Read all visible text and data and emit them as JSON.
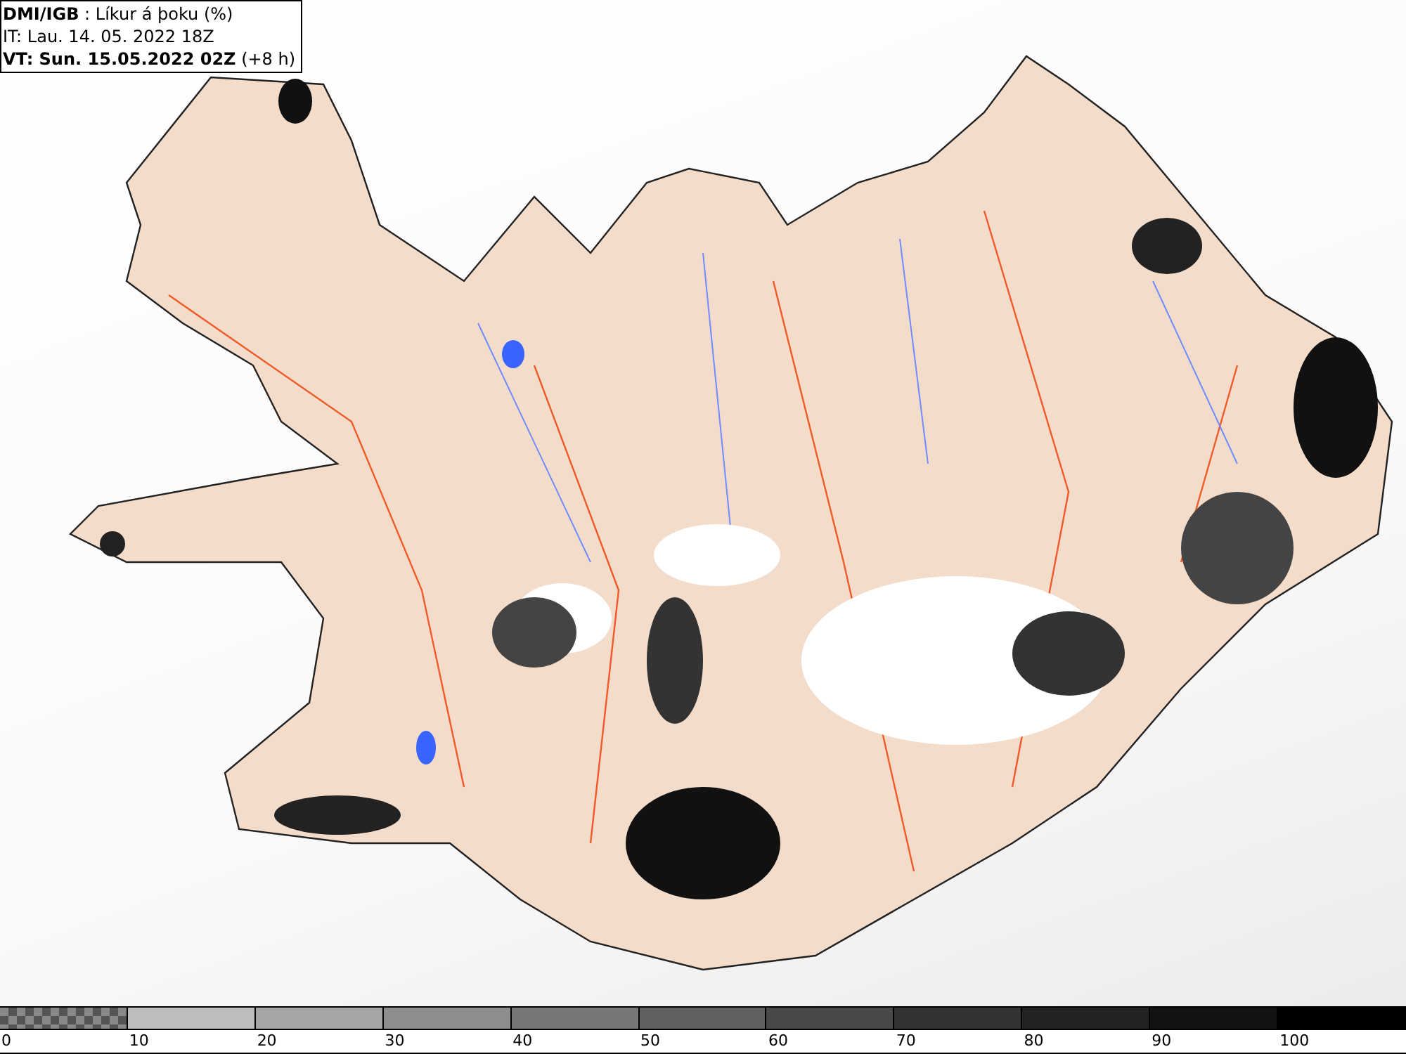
{
  "header": {
    "lines": [
      "**DMI/IGB** : Líkur á þoku (%)",
      "IT: Lau. 14. 05. 2022 18Z",
      "**VT: Sun. 15.05.2022 02Z** (+8 h)"
    ]
  },
  "legend": {
    "segments": [
      {
        "kind": "checker",
        "label": "0"
      },
      {
        "kind": "solid",
        "color": "#bdbdbd",
        "label": "10"
      },
      {
        "kind": "solid",
        "color": "#a6a6a6",
        "label": "20"
      },
      {
        "kind": "solid",
        "color": "#8e8e8e",
        "label": "30"
      },
      {
        "kind": "solid",
        "color": "#777777",
        "label": "40"
      },
      {
        "kind": "solid",
        "color": "#606060",
        "label": "50"
      },
      {
        "kind": "solid",
        "color": "#494949",
        "label": "60"
      },
      {
        "kind": "solid",
        "color": "#333333",
        "label": "70"
      },
      {
        "kind": "solid",
        "color": "#222222",
        "label": "80"
      },
      {
        "kind": "solid",
        "color": "#121212",
        "label": "90"
      },
      {
        "kind": "solid",
        "color": "#000000",
        "label": "100"
      }
    ]
  }
}
